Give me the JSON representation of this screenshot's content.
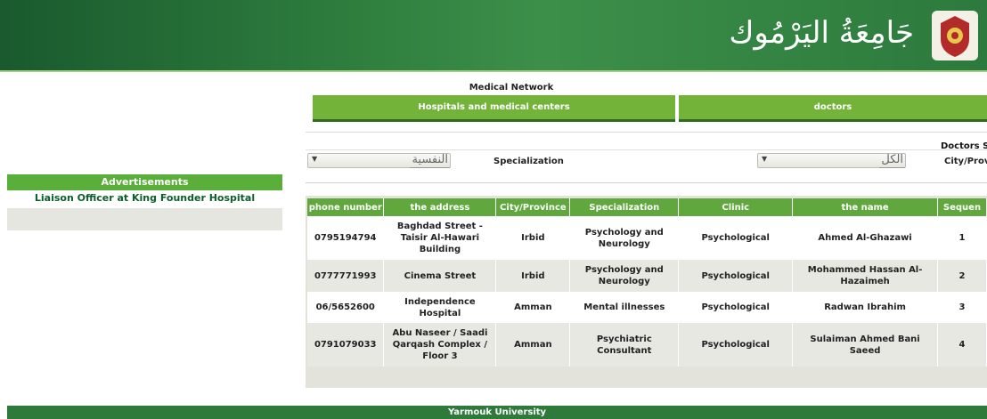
{
  "header": {
    "logo_text": "جَامِعَةُ اليَرْمُوك",
    "colors": {
      "header_green": "#2e7d3e",
      "accent_green": "#74b33a"
    }
  },
  "sidebar": {
    "title": "Advertisements",
    "items": [
      "Liaison Officer at King Founder Hospital"
    ]
  },
  "main": {
    "title": "Medical Network",
    "tabs": [
      {
        "label": "Hospitals and medical centers"
      },
      {
        "label": "doctors"
      }
    ],
    "doctors_search_label": "Doctors Se",
    "filters": {
      "specialization_label": "Specialization",
      "specialization_value": "النفسية",
      "city_label": "City/Provi",
      "city_value": "الكل"
    },
    "table": {
      "headers": [
        "phone number",
        "the address",
        "City/Province",
        "Specialization",
        "Clinic",
        "the name",
        "Sequen"
      ],
      "rows": [
        [
          "0795194794",
          "Baghdad Street - Taisir Al-Hawari Building",
          "Irbid",
          "Psychology and Neurology",
          "Psychological",
          "Ahmed Al-Ghazawi",
          "1"
        ],
        [
          "0777771993",
          "Cinema Street",
          "Irbid",
          "Psychology and Neurology",
          "Psychological",
          "Mohammed Hassan Al-Hazaimeh",
          "2"
        ],
        [
          "06/5652600",
          "Independence Hospital",
          "Amman",
          "Mental illnesses",
          "Psychological",
          "Radwan Ibrahim",
          "3"
        ],
        [
          "0791079033",
          "Abu Naseer / Saadi Qarqash Complex / Floor 3",
          "Amman",
          "Psychiatric Consultant",
          "Psychological",
          "Sulaiman Ahmed Bani Saeed",
          "4"
        ]
      ]
    }
  },
  "footer": {
    "text": "Yarmouk University"
  }
}
